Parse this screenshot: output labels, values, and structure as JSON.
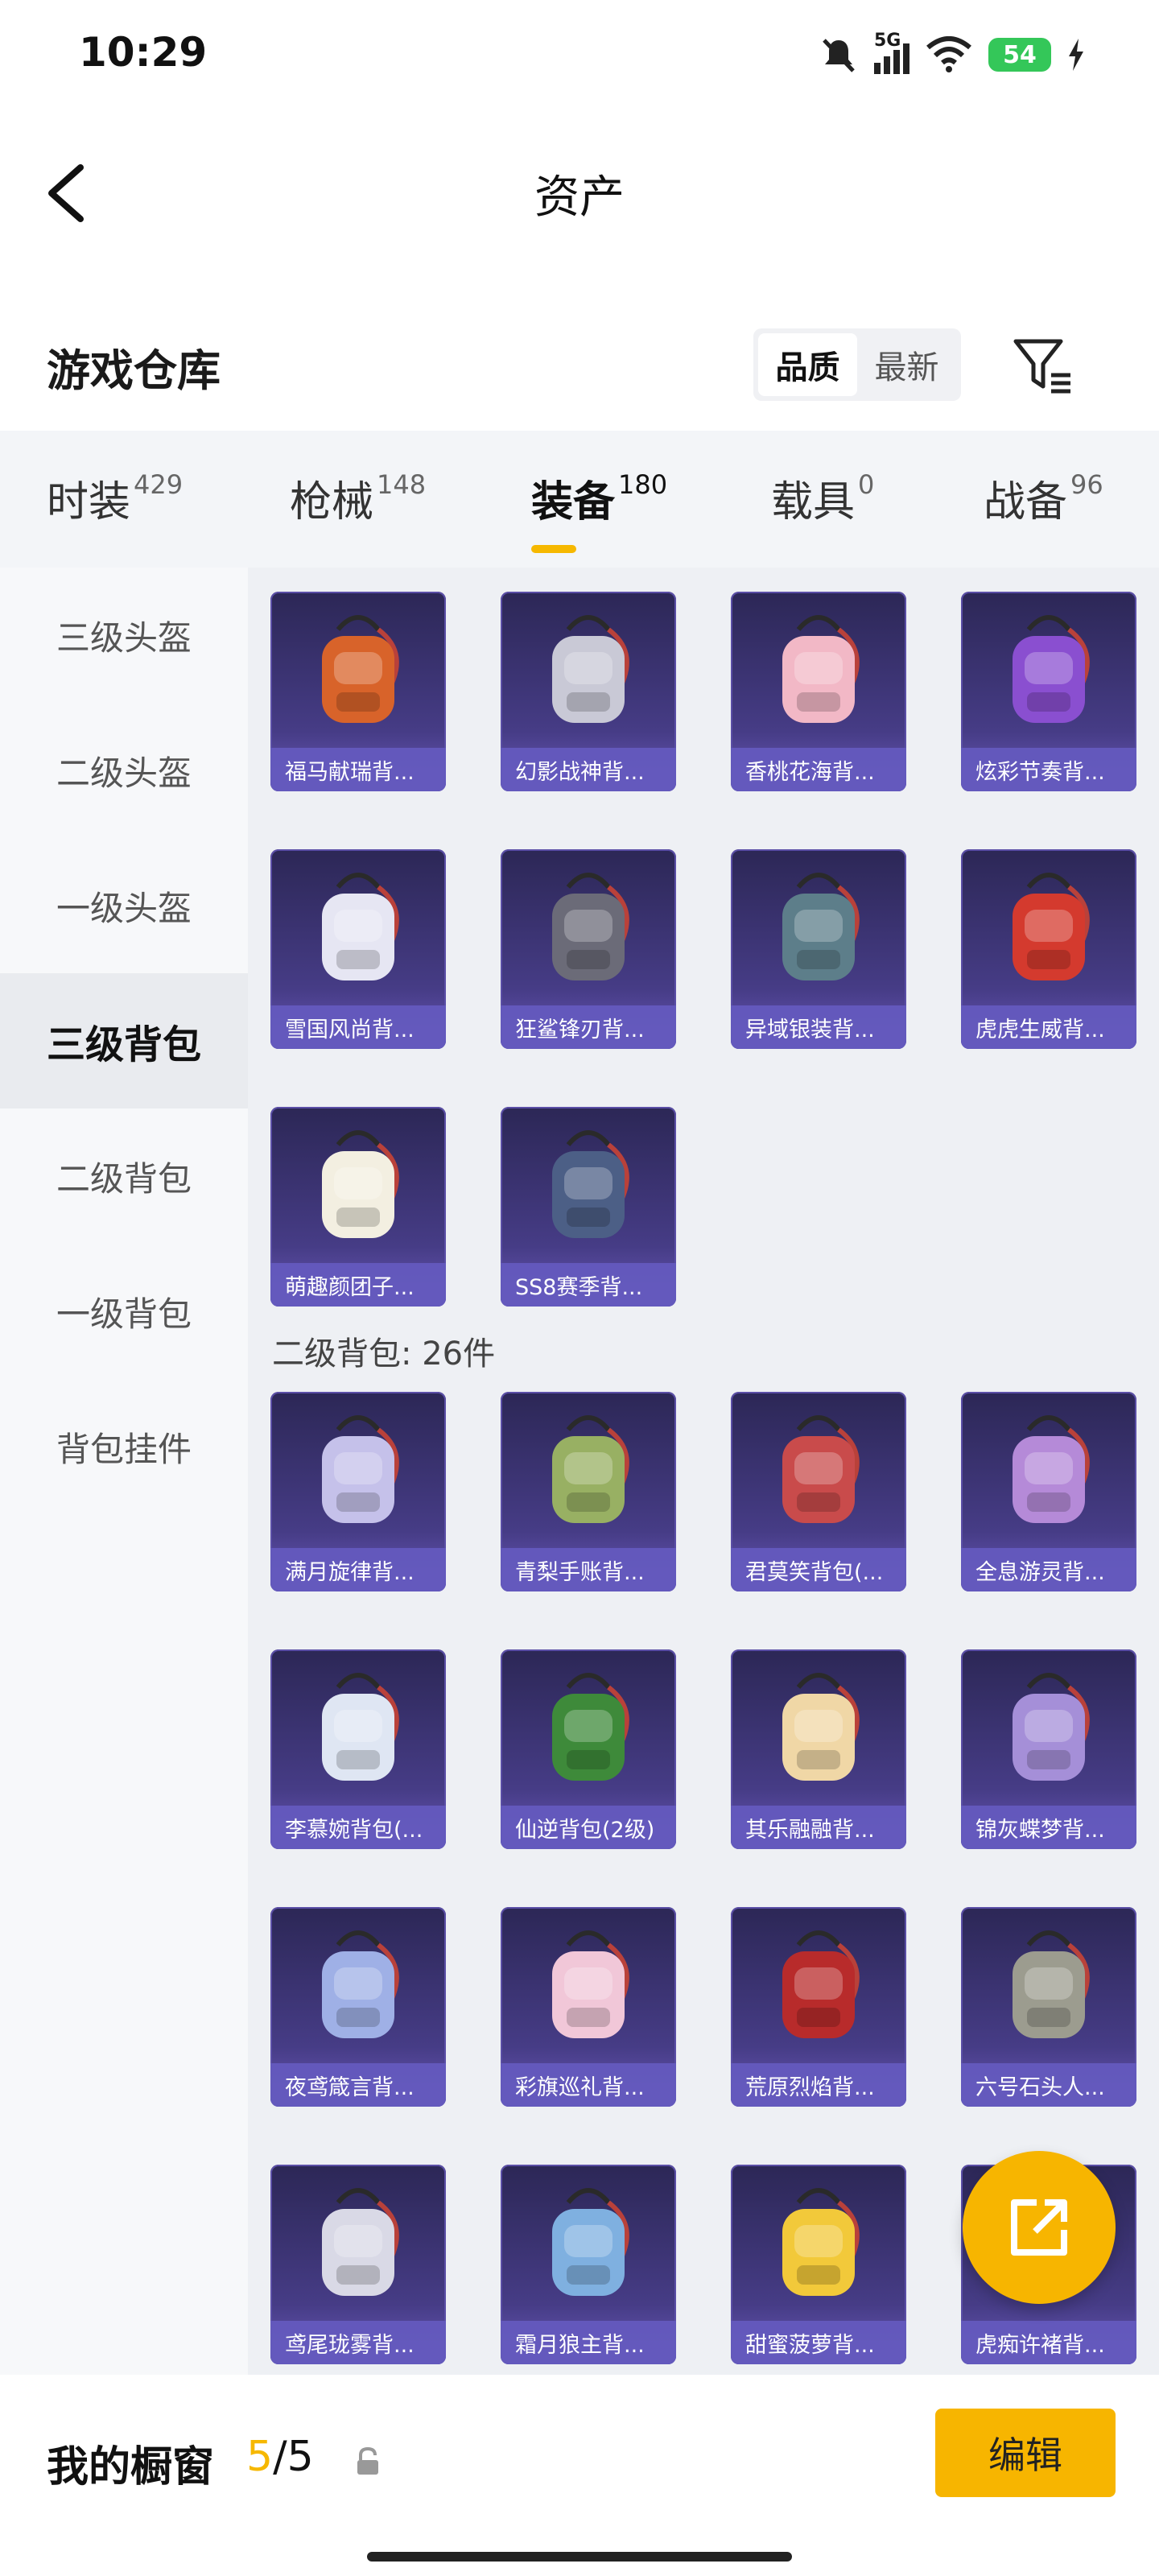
{
  "status": {
    "time": "10:29",
    "network": "5G",
    "battery": "54"
  },
  "header": {
    "title": "资产"
  },
  "warehouse": {
    "title": "游戏仓库",
    "sort_options": [
      "品质",
      "最新"
    ],
    "sort_selected": "品质"
  },
  "tabs": [
    {
      "label": "时装",
      "count": "429"
    },
    {
      "label": "枪械",
      "count": "148"
    },
    {
      "label": "装备",
      "count": "180"
    },
    {
      "label": "载具",
      "count": "0"
    },
    {
      "label": "战备",
      "count": "96"
    }
  ],
  "active_tab": "装备",
  "sidebar": {
    "items": [
      "三级头盔",
      "二级头盔",
      "一级头盔",
      "三级背包",
      "二级背包",
      "一级背包",
      "背包挂件"
    ],
    "active": "三级背包"
  },
  "section1": {
    "items": [
      {
        "name": "福马献瑞背...",
        "icon": "rabbit-backpack-icon",
        "color": "#d8632a"
      },
      {
        "name": "幻影战神背...",
        "icon": "armor-backpack-icon",
        "color": "#c9c9d6"
      },
      {
        "name": "香桃花海背...",
        "icon": "flower-backpack-icon",
        "color": "#f2b8c6"
      },
      {
        "name": "炫彩节奏背...",
        "icon": "festival-backpack-icon",
        "color": "#8a4fd0"
      },
      {
        "name": "雪国风尚背...",
        "icon": "penguin-backpack-icon",
        "color": "#e6e6f3"
      },
      {
        "name": "狂鲨锋刃背...",
        "icon": "shark-backpack-icon",
        "color": "#6b6b78"
      },
      {
        "name": "异域银装背...",
        "icon": "tactical-backpack-icon",
        "color": "#5d7e8a"
      },
      {
        "name": "虎虎生威背...",
        "icon": "tiger-backpack-icon",
        "color": "#d43a2e"
      },
      {
        "name": "萌趣颜团子...",
        "icon": "dumpling-backpack-icon",
        "color": "#f3efe1"
      },
      {
        "name": "SS8赛季背...",
        "icon": "season-backpack-icon",
        "color": "#4c5f86"
      }
    ]
  },
  "section2": {
    "label": "二级背包: 26件",
    "items": [
      {
        "name": "满月旋律背...",
        "icon": "moon-pendant-icon",
        "color": "#c5c1ea"
      },
      {
        "name": "青梨手账背...",
        "icon": "pear-pouch-icon",
        "color": "#98b063"
      },
      {
        "name": "君莫笑背包(...",
        "icon": "emblem-pendant-icon",
        "color": "#c94b4b"
      },
      {
        "name": "全息游灵背...",
        "icon": "controller-pouch-icon",
        "color": "#b58ad8"
      },
      {
        "name": "李慕婉背包(...",
        "icon": "dress-pouch-icon",
        "color": "#dfe6f3"
      },
      {
        "name": "仙逆背包(2级)",
        "icon": "jade-pendant-icon",
        "color": "#3e8a3a"
      },
      {
        "name": "其乐融融背...",
        "icon": "cupcake-pouch-icon",
        "color": "#f0d7a6"
      },
      {
        "name": "锦灰蝶梦背...",
        "icon": "crystal-pendant-icon",
        "color": "#a58fd8"
      },
      {
        "name": "夜鸢箴言背...",
        "icon": "feather-pendant-icon",
        "color": "#9fb0e6"
      },
      {
        "name": "彩旗巡礼背...",
        "icon": "bow-pouch-icon",
        "color": "#f1c7d8"
      },
      {
        "name": "荒原烈焰背...",
        "icon": "flame-pouch-icon",
        "color": "#b82b2b"
      },
      {
        "name": "六号石头人...",
        "icon": "golem-pouch-icon",
        "color": "#9c9c8f"
      },
      {
        "name": "鸢尾珑雾背...",
        "icon": "iris-pouch-icon",
        "color": "#d9d9e6"
      },
      {
        "name": "霜月狼主背...",
        "icon": "wolf-eye-pendant-icon",
        "color": "#7fb0e0"
      },
      {
        "name": "甜蜜菠萝背...",
        "icon": "pineapple-backpack-icon",
        "color": "#f2c93a"
      },
      {
        "name": "虎痴许褚背...",
        "icon": "warrior-pouch-icon",
        "color": "#8a6a52"
      }
    ]
  },
  "fab": {
    "icon": "share-icon"
  },
  "bottom": {
    "label": "我的橱窗",
    "current": "5",
    "total": "/5",
    "edit_label": "编辑"
  }
}
